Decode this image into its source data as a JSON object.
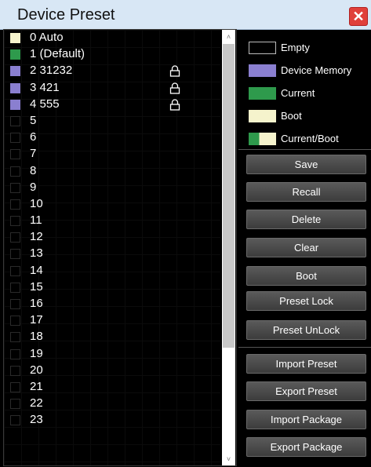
{
  "window": {
    "title": "Device Preset",
    "close_glyph": "✕"
  },
  "presets": [
    {
      "label": "0  Auto",
      "status": "boot",
      "locked": false
    },
    {
      "label": "1  (Default)",
      "status": "current",
      "locked": false
    },
    {
      "label": "2  31232",
      "status": "device_memory",
      "locked": true
    },
    {
      "label": "3  421",
      "status": "device_memory",
      "locked": true
    },
    {
      "label": "4  555",
      "status": "device_memory",
      "locked": true
    },
    {
      "label": "5",
      "status": "empty",
      "locked": false
    },
    {
      "label": "6",
      "status": "empty",
      "locked": false
    },
    {
      "label": "7",
      "status": "empty",
      "locked": false
    },
    {
      "label": "8",
      "status": "empty",
      "locked": false
    },
    {
      "label": "9",
      "status": "empty",
      "locked": false
    },
    {
      "label": "10",
      "status": "empty",
      "locked": false
    },
    {
      "label": "11",
      "status": "empty",
      "locked": false
    },
    {
      "label": "12",
      "status": "empty",
      "locked": false
    },
    {
      "label": "13",
      "status": "empty",
      "locked": false
    },
    {
      "label": "14",
      "status": "empty",
      "locked": false
    },
    {
      "label": "15",
      "status": "empty",
      "locked": false
    },
    {
      "label": "16",
      "status": "empty",
      "locked": false
    },
    {
      "label": "17",
      "status": "empty",
      "locked": false
    },
    {
      "label": "18",
      "status": "empty",
      "locked": false
    },
    {
      "label": "19",
      "status": "empty",
      "locked": false
    },
    {
      "label": "20",
      "status": "empty",
      "locked": false
    },
    {
      "label": "21",
      "status": "empty",
      "locked": false
    },
    {
      "label": "22",
      "status": "empty",
      "locked": false
    },
    {
      "label": "23",
      "status": "empty",
      "locked": false
    }
  ],
  "status_colors": {
    "empty": "#000000",
    "device_memory": "#8a7fd0",
    "current": "#2e9a4c",
    "boot": "#f5f3cc"
  },
  "legend": {
    "empty": "Empty",
    "device_memory": "Device Memory",
    "current": "Current",
    "boot": "Boot",
    "current_boot": "Current/Boot"
  },
  "buttons": {
    "save": "Save",
    "recall": "Recall",
    "delete": "Delete",
    "clear": "Clear",
    "boot": "Boot",
    "preset_lock": "Preset Lock",
    "preset_unlock": "Preset UnLock",
    "import_preset": "Import Preset",
    "export_preset": "Export Preset",
    "import_package": "Import Package",
    "export_package": "Export Package"
  },
  "scrollbar": {
    "up_glyph": "˄",
    "down_glyph": "˅"
  }
}
